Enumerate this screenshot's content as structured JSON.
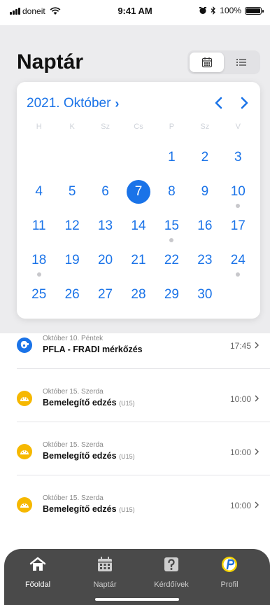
{
  "status_bar": {
    "carrier": "doneit",
    "time": "9:41 AM",
    "battery": "100%"
  },
  "header": {
    "title": "Naptár",
    "view_toggle": [
      "calendar-view-icon",
      "list-view-icon"
    ]
  },
  "calendar": {
    "month_label": "2021. Október",
    "weekdays": [
      "H",
      "K",
      "Sz",
      "Cs",
      "P",
      "Sz",
      "V"
    ],
    "days": [
      "1",
      "2",
      "3",
      "4",
      "5",
      "6",
      "7",
      "8",
      "9",
      "10",
      "11",
      "12",
      "13",
      "14",
      "15",
      "16",
      "17",
      "18",
      "19",
      "20",
      "21",
      "22",
      "23",
      "24",
      "25",
      "26",
      "27",
      "28",
      "29",
      "30"
    ],
    "selected_day": "7",
    "days_with_events": [
      "10",
      "15",
      "18",
      "24"
    ]
  },
  "events": [
    {
      "date": "Október 10. Péntek",
      "title": "PFLA - FRADI mérkőzés",
      "tag": "",
      "time": "17:45",
      "icon": "match-icon",
      "color": "#1a73e8"
    },
    {
      "date": "Október 15. Szerda",
      "title": "Bemelegítő edzés",
      "tag": "(U15)",
      "time": "10:00",
      "icon": "training-icon",
      "color": "#f6b800"
    },
    {
      "date": "Október 15. Szerda",
      "title": "Bemelegítő edzés",
      "tag": "(U15)",
      "time": "10:00",
      "icon": "training-icon",
      "color": "#f6b800"
    },
    {
      "date": "Október 15. Szerda",
      "title": "Bemelegítő edzés",
      "tag": "(U15)",
      "time": "10:00",
      "icon": "training-icon",
      "color": "#f6b800"
    }
  ],
  "tabbar": {
    "tabs": [
      {
        "label": "Főoldal",
        "icon": "home-icon",
        "active": true
      },
      {
        "label": "Naptár",
        "icon": "calendar-icon",
        "active": false
      },
      {
        "label": "Kérdőívek",
        "icon": "question-icon",
        "active": false
      },
      {
        "label": "Profil",
        "icon": "profile-logo-icon",
        "active": false
      }
    ]
  },
  "colors": {
    "accent": "#1a73e8",
    "training": "#f6b800",
    "tabbar_bg": "#4a4a4a"
  }
}
